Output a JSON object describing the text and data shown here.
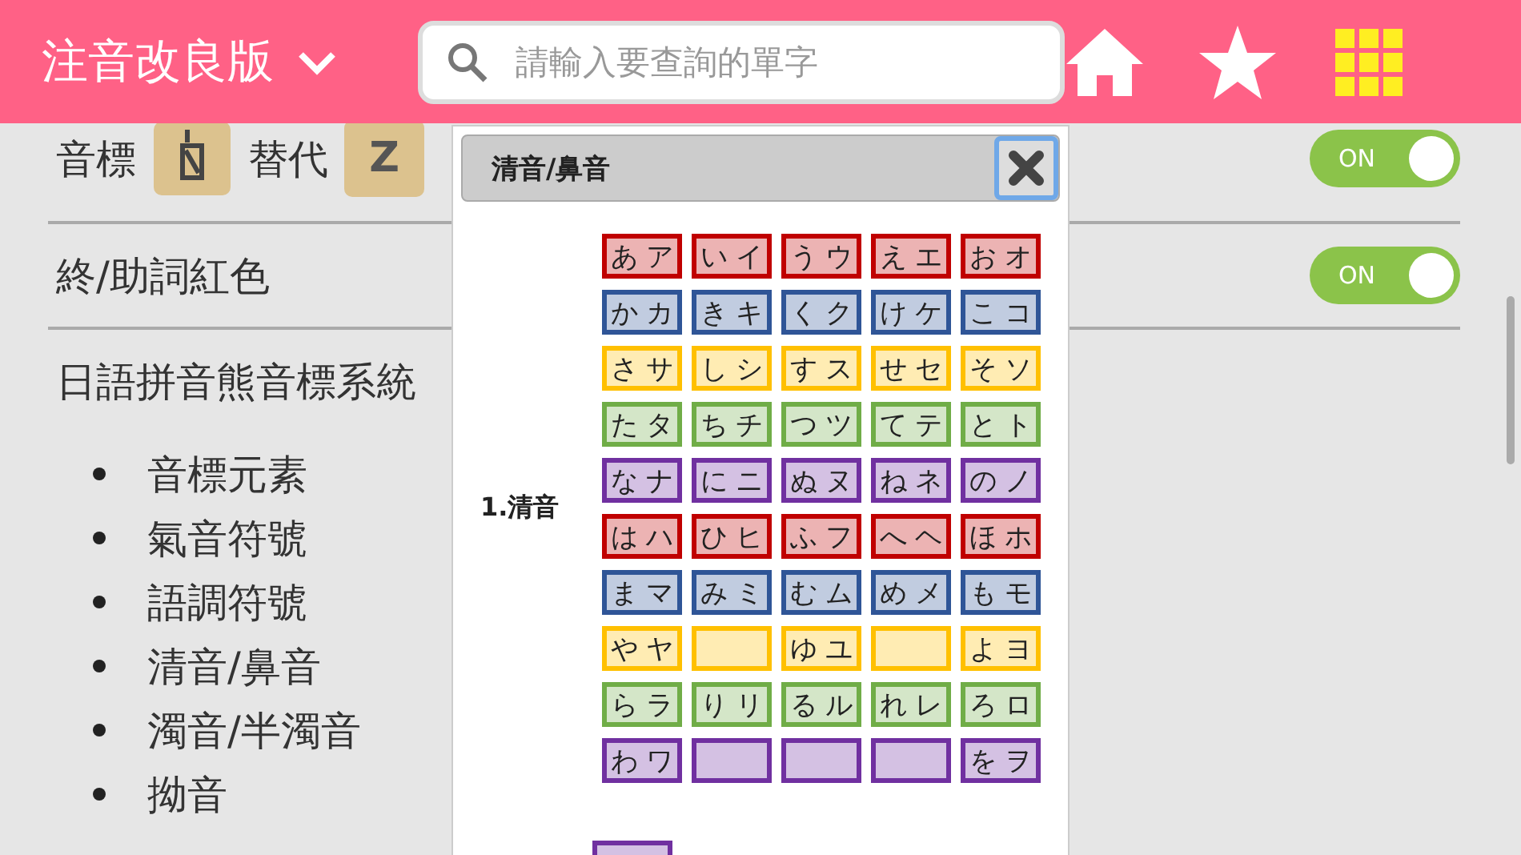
{
  "header": {
    "title": "注音改良版",
    "search": {
      "placeholder": "請輸入要查詢的單字"
    }
  },
  "settings": {
    "symbol_row": {
      "label": "音標",
      "alt_label": "替代",
      "alt_key": "Z"
    },
    "toggles": [
      {
        "label": "ON",
        "on": true
      },
      {
        "label": "ON",
        "on": true,
        "text": "終/助詞紅色"
      }
    ],
    "system_title": "日語拼音熊音標系統",
    "items": [
      "音標元素",
      "氣音符號",
      "語調符號",
      "清音/鼻音",
      "濁音/半濁音",
      "拗音"
    ]
  },
  "dialog": {
    "title": "清音/鼻音",
    "section": "1.清音",
    "rows": [
      {
        "color": "#c00000",
        "cells": [
          {
            "kind": "kana",
            "text": "あ ア"
          },
          {
            "kind": "kana",
            "text": "い イ"
          },
          {
            "kind": "kana",
            "text": "う ウ"
          },
          {
            "kind": "kana",
            "text": "え エ"
          },
          {
            "kind": "kana",
            "text": "お オ"
          }
        ]
      },
      {
        "color": "#2f5597",
        "cells": [
          {
            "kind": "kana",
            "text": "か カ"
          },
          {
            "kind": "kana",
            "text": "き キ"
          },
          {
            "kind": "kana",
            "text": "く ク"
          },
          {
            "kind": "kana",
            "text": "け ケ"
          },
          {
            "kind": "kana",
            "text": "こ コ"
          }
        ]
      },
      {
        "color": "#ffc000",
        "cells": [
          {
            "kind": "kana",
            "text": "さ サ"
          },
          {
            "kind": "kana",
            "text": "し シ"
          },
          {
            "kind": "kana",
            "text": "す ス"
          },
          {
            "kind": "kana",
            "text": "せ セ"
          },
          {
            "kind": "kana",
            "text": "そ ソ"
          }
        ]
      },
      {
        "color": "#70ad47",
        "cells": [
          {
            "kind": "kana",
            "text": "た タ"
          },
          {
            "kind": "kana",
            "text": "ち チ"
          },
          {
            "kind": "kana",
            "text": "つ ツ"
          },
          {
            "kind": "kana",
            "text": "て テ"
          },
          {
            "kind": "kana",
            "text": "と ト"
          }
        ]
      },
      {
        "color": "#7030a0",
        "cells": [
          {
            "kind": "kana",
            "text": "な ナ"
          },
          {
            "kind": "kana",
            "text": "に ニ"
          },
          {
            "kind": "kana",
            "text": "ぬ ヌ"
          },
          {
            "kind": "kana",
            "text": "ね ネ"
          },
          {
            "kind": "kana",
            "text": "の ノ"
          }
        ]
      },
      {
        "color": "#c00000",
        "cells": [
          {
            "kind": "kana",
            "text": "は ハ"
          },
          {
            "kind": "kana",
            "text": "ひ ヒ"
          },
          {
            "kind": "kana",
            "text": "ふ フ"
          },
          {
            "kind": "kana",
            "text": "へ ヘ"
          },
          {
            "kind": "kana",
            "text": "ほ ホ"
          }
        ]
      },
      {
        "color": "#2f5597",
        "cells": [
          {
            "kind": "kana",
            "text": "ま マ"
          },
          {
            "kind": "kana",
            "text": "み ミ"
          },
          {
            "kind": "kana",
            "text": "む ム"
          },
          {
            "kind": "kana",
            "text": "め メ"
          },
          {
            "kind": "kana",
            "text": "も モ"
          }
        ]
      },
      {
        "color": "#ffc000",
        "cells": [
          {
            "kind": "kana",
            "text": "や ヤ"
          },
          {
            "kind": "blank"
          },
          {
            "kind": "kana",
            "text": "ゆ ユ"
          },
          {
            "kind": "blank"
          },
          {
            "kind": "kana",
            "text": "よ ヨ"
          }
        ]
      },
      {
        "color": "#70ad47",
        "cells": [
          {
            "kind": "kana",
            "text": "ら ラ"
          },
          {
            "kind": "kana",
            "text": "り リ"
          },
          {
            "kind": "kana",
            "text": "る ル"
          },
          {
            "kind": "kana",
            "text": "れ レ"
          },
          {
            "kind": "kana",
            "text": "ろ ロ"
          }
        ]
      },
      {
        "color": "#7030a0",
        "cells": [
          {
            "kind": "kana",
            "text": "わ ワ"
          },
          {
            "kind": "blank"
          },
          {
            "kind": "blank"
          },
          {
            "kind": "blank"
          },
          {
            "kind": "kana",
            "text": "を ヲ"
          }
        ]
      }
    ],
    "next_section": {
      "color": "#7030a0"
    }
  }
}
